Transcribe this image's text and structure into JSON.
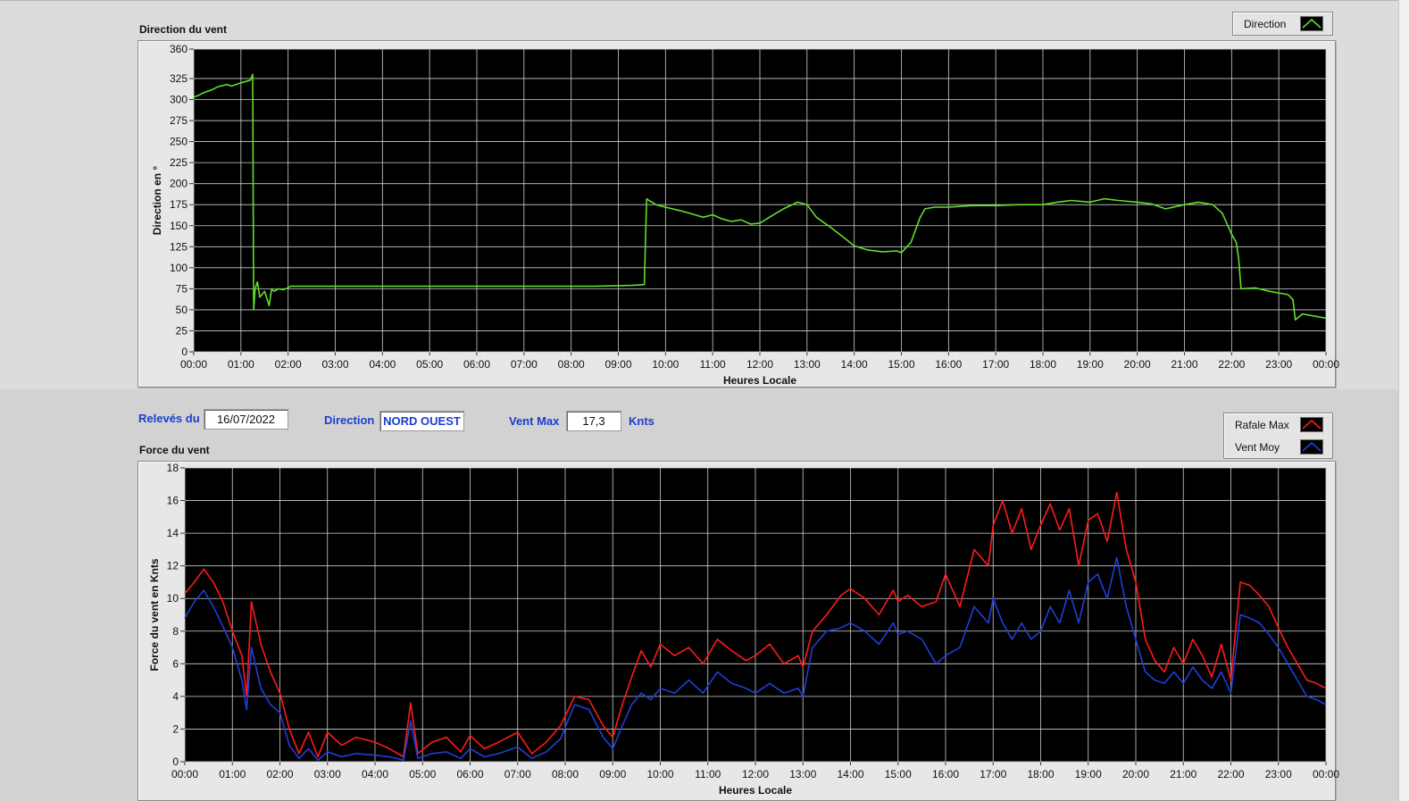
{
  "info": {
    "releves_label": "Relevés du",
    "date": "16/07/2022",
    "direction_label": "Direction",
    "direction_value": "NORD OUEST",
    "ventmax_label": "Vent Max",
    "ventmax_value": "17,3",
    "ventmax_unit": "Knts"
  },
  "colors": {
    "direction": "#5fe02a",
    "rafale": "#ff1a1a",
    "ventmoy": "#1f3fd6",
    "plot_bg": "#000000",
    "grid": "#cfcfcf"
  },
  "chart_data": [
    {
      "type": "line",
      "title": "Direction du vent",
      "xlabel": "Heures Locale",
      "ylabel": "Direction en °",
      "xlim": [
        0,
        24
      ],
      "ylim": [
        0,
        360
      ],
      "yticks": [
        0,
        25,
        50,
        75,
        100,
        125,
        150,
        175,
        200,
        225,
        250,
        275,
        300,
        325,
        360
      ],
      "xtick_labels": [
        "00:00",
        "01:00",
        "02:00",
        "03:00",
        "04:00",
        "05:00",
        "06:00",
        "07:00",
        "08:00",
        "09:00",
        "10:00",
        "11:00",
        "12:00",
        "13:00",
        "14:00",
        "15:00",
        "16:00",
        "17:00",
        "18:00",
        "19:00",
        "20:00",
        "21:00",
        "22:00",
        "23:00",
        "00:00"
      ],
      "grid": true,
      "legend": [
        "Direction"
      ],
      "legend_position": "top-right",
      "series": [
        {
          "name": "Direction",
          "x": [
            0.0,
            0.1,
            0.2,
            0.4,
            0.5,
            0.7,
            0.8,
            1.0,
            1.2,
            1.25,
            1.27,
            1.3,
            1.35,
            1.4,
            1.5,
            1.6,
            1.65,
            1.7,
            1.8,
            1.9,
            2.0,
            2.05,
            2.5,
            3.5,
            4.5,
            5.5,
            6.5,
            7.5,
            8.5,
            9.3,
            9.55,
            9.6,
            9.65,
            9.8,
            10.0,
            10.3,
            10.5,
            10.8,
            11.0,
            11.2,
            11.4,
            11.6,
            11.8,
            12.0,
            12.2,
            12.5,
            12.8,
            13.0,
            13.2,
            13.5,
            13.8,
            14.0,
            14.3,
            14.6,
            14.9,
            15.0,
            15.2,
            15.4,
            15.5,
            15.7,
            16.0,
            16.5,
            17.0,
            17.5,
            18.0,
            18.3,
            18.6,
            19.0,
            19.3,
            19.6,
            20.0,
            20.3,
            20.6,
            21.0,
            21.3,
            21.6,
            21.8,
            22.0,
            22.1,
            22.15,
            22.2,
            22.5,
            22.8,
            23.0,
            23.2,
            23.3,
            23.35,
            23.5,
            23.8,
            24.0
          ],
          "y": [
            303,
            305,
            308,
            312,
            315,
            318,
            316,
            320,
            323,
            330,
            50,
            75,
            83,
            65,
            72,
            55,
            75,
            72,
            75,
            74,
            76,
            78,
            78,
            78,
            78,
            78,
            78,
            78,
            78,
            79,
            80,
            182,
            180,
            175,
            172,
            168,
            165,
            160,
            163,
            158,
            155,
            157,
            152,
            153,
            160,
            170,
            178,
            175,
            160,
            148,
            135,
            126,
            121,
            119,
            120,
            118,
            130,
            160,
            170,
            172,
            172,
            174,
            174,
            175,
            175,
            178,
            180,
            178,
            182,
            180,
            178,
            176,
            170,
            175,
            178,
            175,
            165,
            140,
            130,
            110,
            75,
            76,
            72,
            70,
            68,
            62,
            38,
            45,
            42,
            40
          ]
        }
      ]
    },
    {
      "type": "line",
      "title": "Force du vent",
      "xlabel": "Heures Locale",
      "ylabel": "Force du vent en Knts",
      "xlim": [
        0,
        24
      ],
      "ylim": [
        0,
        18
      ],
      "yticks": [
        0,
        2,
        4,
        6,
        8,
        10,
        12,
        14,
        16,
        18
      ],
      "xtick_labels": [
        "00:00",
        "01:00",
        "02:00",
        "03:00",
        "04:00",
        "05:00",
        "06:00",
        "07:00",
        "08:00",
        "09:00",
        "10:00",
        "11:00",
        "12:00",
        "13:00",
        "14:00",
        "15:00",
        "16:00",
        "17:00",
        "18:00",
        "19:00",
        "20:00",
        "21:00",
        "22:00",
        "23:00",
        "00:00"
      ],
      "grid": true,
      "legend": [
        "Rafale Max",
        "Vent Moy"
      ],
      "legend_position": "top-right",
      "series": [
        {
          "name": "Rafale Max",
          "x": [
            0.0,
            0.2,
            0.4,
            0.6,
            0.8,
            1.0,
            1.2,
            1.3,
            1.4,
            1.6,
            1.8,
            2.0,
            2.2,
            2.4,
            2.6,
            2.8,
            3.0,
            3.3,
            3.6,
            4.0,
            4.3,
            4.6,
            4.75,
            4.9,
            5.2,
            5.5,
            5.8,
            6.0,
            6.3,
            6.6,
            7.0,
            7.3,
            7.6,
            7.9,
            8.2,
            8.5,
            8.8,
            9.0,
            9.2,
            9.4,
            9.6,
            9.8,
            10.0,
            10.3,
            10.6,
            10.9,
            11.2,
            11.5,
            11.8,
            12.0,
            12.3,
            12.6,
            12.9,
            13.0,
            13.2,
            13.5,
            13.8,
            14.0,
            14.3,
            14.6,
            14.9,
            15.0,
            15.2,
            15.5,
            15.8,
            16.0,
            16.3,
            16.6,
            16.9,
            17.0,
            17.2,
            17.4,
            17.6,
            17.8,
            18.0,
            18.2,
            18.4,
            18.6,
            18.8,
            19.0,
            19.2,
            19.4,
            19.6,
            19.8,
            20.0,
            20.2,
            20.4,
            20.6,
            20.8,
            21.0,
            21.2,
            21.4,
            21.6,
            21.8,
            22.0,
            22.2,
            22.4,
            22.6,
            22.8,
            23.0,
            23.2,
            23.4,
            23.6,
            23.8,
            24.0
          ],
          "y": [
            10.3,
            11.0,
            11.8,
            11.0,
            9.8,
            8.0,
            6.5,
            4.0,
            9.8,
            7.2,
            5.5,
            4.2,
            2.0,
            0.5,
            1.8,
            0.3,
            1.8,
            1.0,
            1.5,
            1.2,
            0.8,
            0.3,
            3.6,
            0.5,
            1.2,
            1.5,
            0.6,
            1.6,
            0.8,
            1.2,
            1.8,
            0.5,
            1.2,
            2.2,
            4.0,
            3.8,
            2.2,
            1.5,
            3.5,
            5.2,
            6.8,
            5.8,
            7.2,
            6.5,
            7.0,
            6.0,
            7.5,
            6.8,
            6.2,
            6.5,
            7.2,
            6.0,
            6.5,
            5.8,
            8.0,
            9.0,
            10.2,
            10.6,
            10.0,
            9.0,
            10.5,
            9.8,
            10.2,
            9.5,
            9.8,
            11.5,
            9.5,
            13.0,
            12.0,
            14.5,
            16.0,
            14.0,
            15.5,
            13.0,
            14.5,
            15.8,
            14.2,
            15.5,
            12.0,
            14.8,
            15.2,
            13.5,
            16.5,
            13.0,
            11.0,
            7.5,
            6.2,
            5.5,
            7.0,
            6.0,
            7.5,
            6.5,
            5.2,
            7.2,
            5.0,
            11.0,
            10.8,
            10.2,
            9.5,
            8.2,
            7.0,
            6.0,
            5.0,
            4.8,
            4.5
          ]
        },
        {
          "name": "Vent Moy",
          "x": [
            0.0,
            0.2,
            0.4,
            0.6,
            0.8,
            1.0,
            1.2,
            1.3,
            1.4,
            1.6,
            1.8,
            2.0,
            2.2,
            2.4,
            2.6,
            2.8,
            3.0,
            3.3,
            3.6,
            4.0,
            4.3,
            4.6,
            4.75,
            4.9,
            5.2,
            5.5,
            5.8,
            6.0,
            6.3,
            6.6,
            7.0,
            7.3,
            7.6,
            7.9,
            8.2,
            8.5,
            8.8,
            9.0,
            9.2,
            9.4,
            9.6,
            9.8,
            10.0,
            10.3,
            10.6,
            10.9,
            11.2,
            11.5,
            11.8,
            12.0,
            12.3,
            12.6,
            12.9,
            13.0,
            13.2,
            13.5,
            13.8,
            14.0,
            14.3,
            14.6,
            14.9,
            15.0,
            15.2,
            15.5,
            15.8,
            16.0,
            16.3,
            16.6,
            16.9,
            17.0,
            17.2,
            17.4,
            17.6,
            17.8,
            18.0,
            18.2,
            18.4,
            18.6,
            18.8,
            19.0,
            19.2,
            19.4,
            19.6,
            19.8,
            20.0,
            20.2,
            20.4,
            20.6,
            20.8,
            21.0,
            21.2,
            21.4,
            21.6,
            21.8,
            22.0,
            22.2,
            22.4,
            22.6,
            22.8,
            23.0,
            23.2,
            23.4,
            23.6,
            23.8,
            24.0
          ],
          "y": [
            8.8,
            9.8,
            10.5,
            9.5,
            8.3,
            7.0,
            5.0,
            3.2,
            7.0,
            4.5,
            3.5,
            3.0,
            1.0,
            0.2,
            0.8,
            0.1,
            0.6,
            0.3,
            0.5,
            0.4,
            0.3,
            0.1,
            2.5,
            0.2,
            0.5,
            0.6,
            0.2,
            0.8,
            0.3,
            0.5,
            0.9,
            0.2,
            0.6,
            1.4,
            3.5,
            3.2,
            1.5,
            0.8,
            2.2,
            3.5,
            4.2,
            3.8,
            4.5,
            4.2,
            5.0,
            4.2,
            5.5,
            4.8,
            4.5,
            4.2,
            4.8,
            4.2,
            4.5,
            4.0,
            7.0,
            8.0,
            8.2,
            8.5,
            8.0,
            7.2,
            8.5,
            7.8,
            8.0,
            7.5,
            6.0,
            6.5,
            7.0,
            9.5,
            8.5,
            10.0,
            8.5,
            7.5,
            8.5,
            7.5,
            8.0,
            9.5,
            8.5,
            10.5,
            8.5,
            11.0,
            11.5,
            10.0,
            12.5,
            9.5,
            7.5,
            5.5,
            5.0,
            4.8,
            5.5,
            4.8,
            5.8,
            5.0,
            4.5,
            5.5,
            4.2,
            9.0,
            8.8,
            8.5,
            7.8,
            7.0,
            6.0,
            5.0,
            4.0,
            3.8,
            3.5
          ]
        }
      ]
    }
  ]
}
